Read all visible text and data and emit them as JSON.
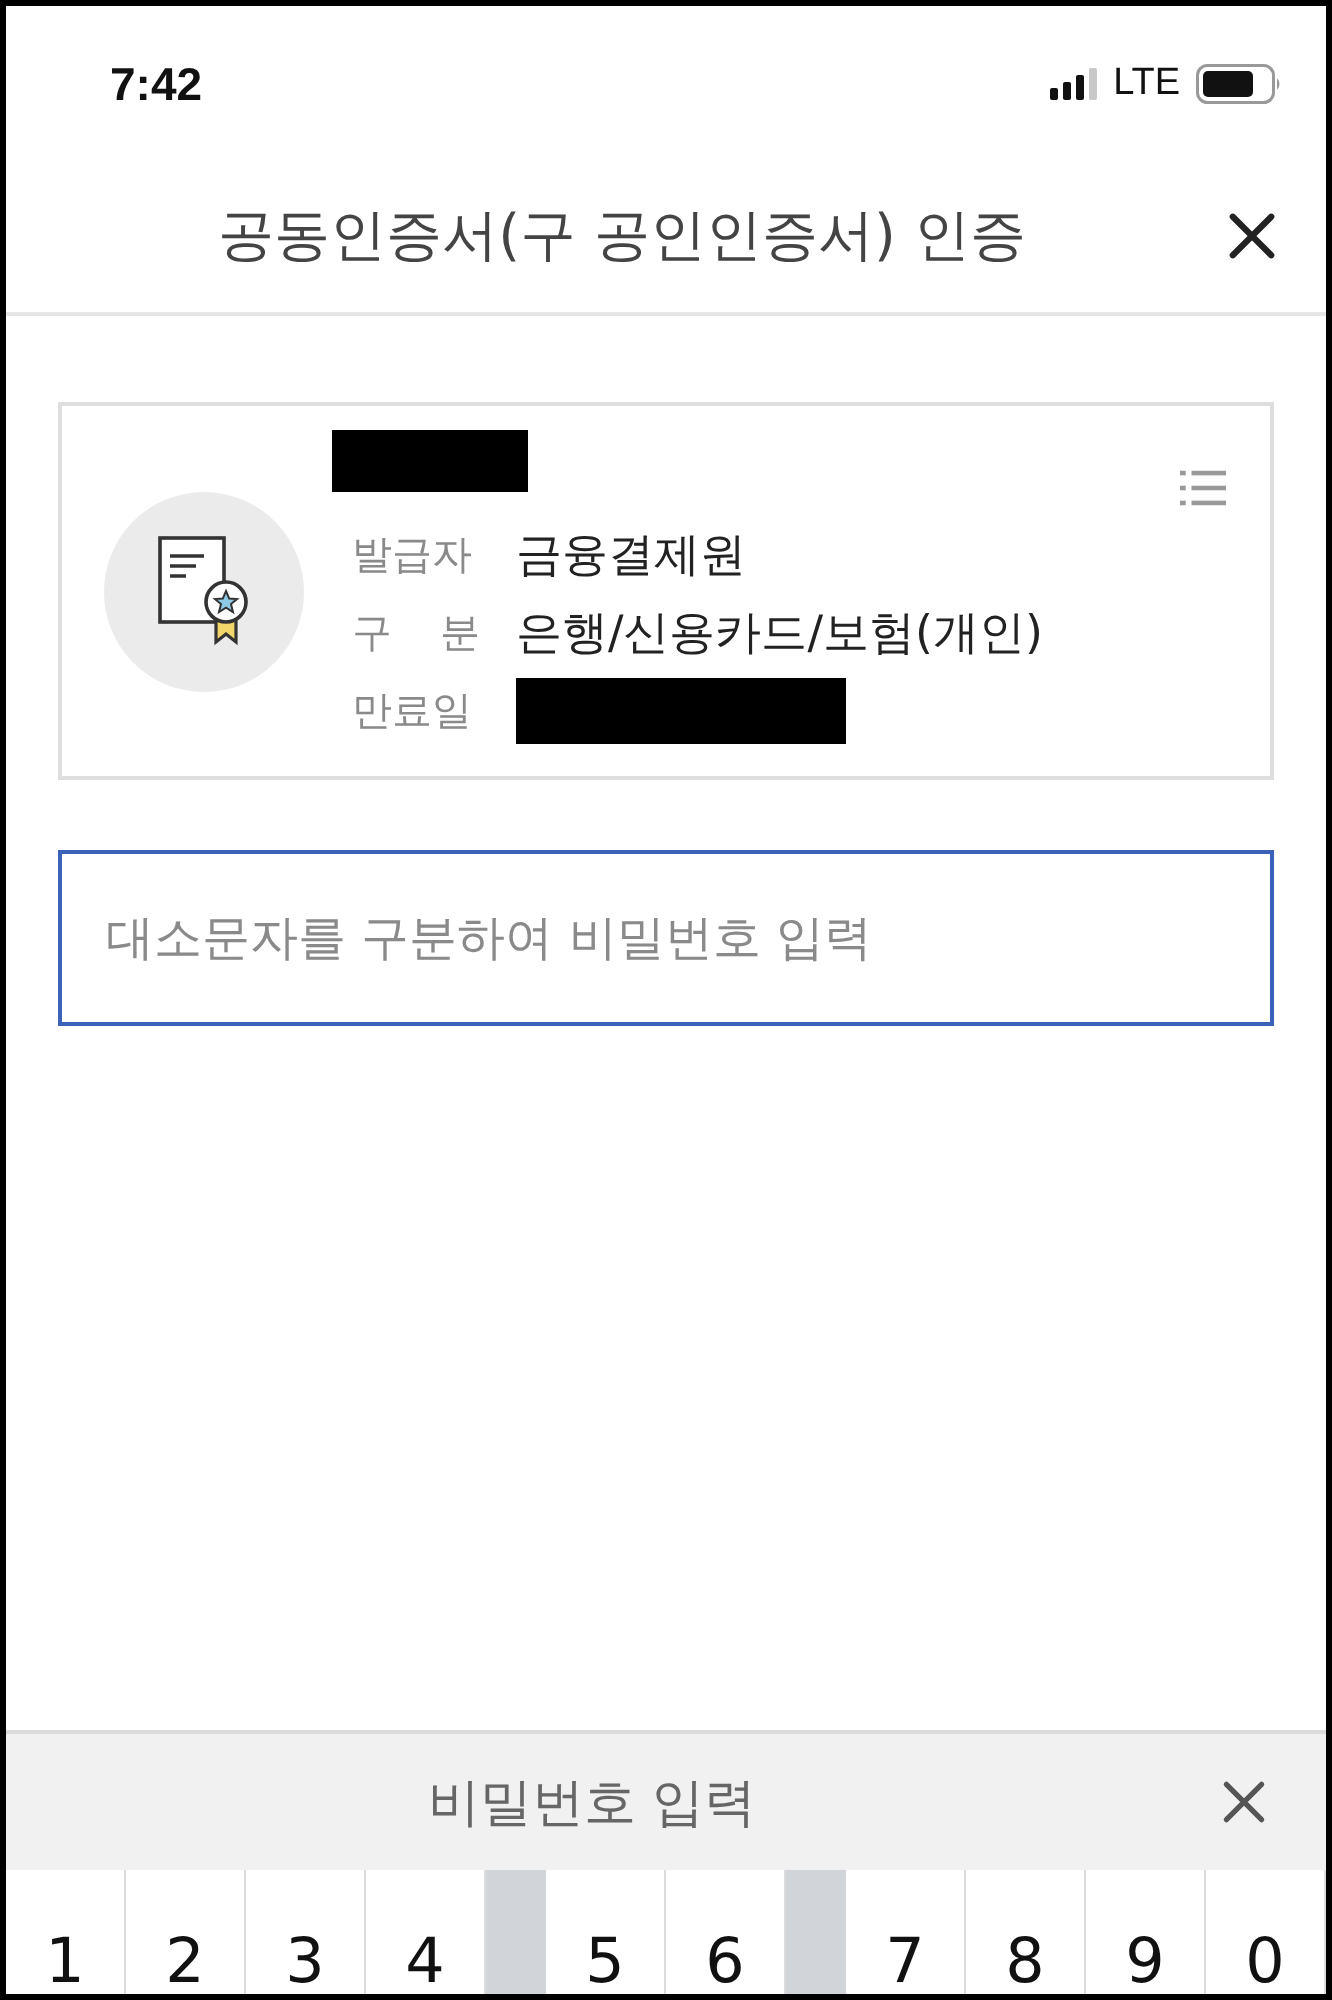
{
  "status_bar": {
    "time": "7:42",
    "network": "LTE"
  },
  "header": {
    "title": "공동인증서(구 공인인증서) 인증"
  },
  "certificate": {
    "name": {
      "redacted": true
    },
    "rows": [
      {
        "label": "발급자",
        "value": "금융결제원",
        "redacted": false
      },
      {
        "label": "구 분",
        "value": "은행/신용카드/보험(개인)",
        "redacted": false
      },
      {
        "label": "만료일",
        "redacted": true
      }
    ]
  },
  "password_field": {
    "placeholder": "대소문자를 구분하여 비밀번호 입력"
  },
  "keypad": {
    "title": "비밀번호 입력",
    "keys": [
      {
        "kind": "digit",
        "label": "1"
      },
      {
        "kind": "digit",
        "label": "2"
      },
      {
        "kind": "digit",
        "label": "3"
      },
      {
        "kind": "digit",
        "label": "4"
      },
      {
        "kind": "blank"
      },
      {
        "kind": "digit",
        "label": "5"
      },
      {
        "kind": "digit",
        "label": "6"
      },
      {
        "kind": "blank"
      },
      {
        "kind": "digit",
        "label": "7"
      },
      {
        "kind": "digit",
        "label": "8"
      },
      {
        "kind": "digit",
        "label": "9"
      },
      {
        "kind": "digit",
        "label": "0"
      }
    ]
  }
}
